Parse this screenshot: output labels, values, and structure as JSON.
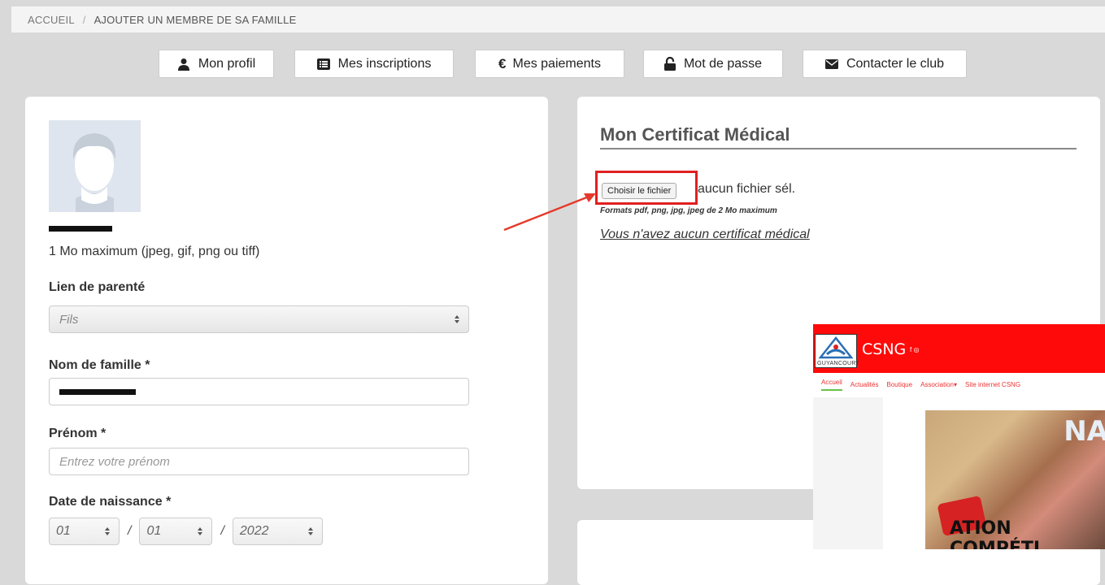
{
  "breadcrumb": {
    "home": "ACCUEIL",
    "separator": "/",
    "current": "AJOUTER UN MEMBRE DE SA FAMILLE"
  },
  "tabs": [
    {
      "label": "Mon profil",
      "icon": "user-icon"
    },
    {
      "label": "Mes inscriptions",
      "icon": "list-icon"
    },
    {
      "label": "Mes paiements",
      "icon": "euro-icon"
    },
    {
      "label": "Mot de passe",
      "icon": "unlock-icon"
    },
    {
      "label": "Contacter le club",
      "icon": "envelope-icon"
    }
  ],
  "profile": {
    "photo_help": "1 Mo maximum (jpeg, gif, png ou tiff)",
    "relation_label": "Lien de parenté",
    "relation_value": "Fils",
    "lastname_label": "Nom de famille *",
    "firstname_label": "Prénom *",
    "firstname_placeholder": "Entrez votre prénom",
    "birthdate_label": "Date de naissance *",
    "birth_day": "01",
    "birth_month": "01",
    "birth_year": "2022",
    "date_separator": "/"
  },
  "certificate": {
    "title": "Mon Certificat Médical",
    "choose_file_label": "Choisir le fichier",
    "no_file_text": "aucun fichier sél.",
    "formats_text": "Formats pdf, png, jpg, jpeg de 2 Mo maximum",
    "no_certificate_text": "Vous n'avez aucun certificat médical"
  },
  "inset": {
    "site_title": "CSNG",
    "social": "f ◎",
    "logo_text": "GUYANCOURT",
    "nav": [
      "Accueil",
      "Actualités",
      "Boutique",
      "Association▾",
      "Site internet CSNG"
    ],
    "photo_sign": "NA",
    "photo_headline": "ATION COMPÉTI"
  },
  "colors": {
    "page_bg": "#d9d9d9",
    "card_bg": "#ffffff",
    "highlight": "#e02020",
    "inset_header": "#ff0a0a",
    "inset_nav_active": "#6bc04b"
  }
}
